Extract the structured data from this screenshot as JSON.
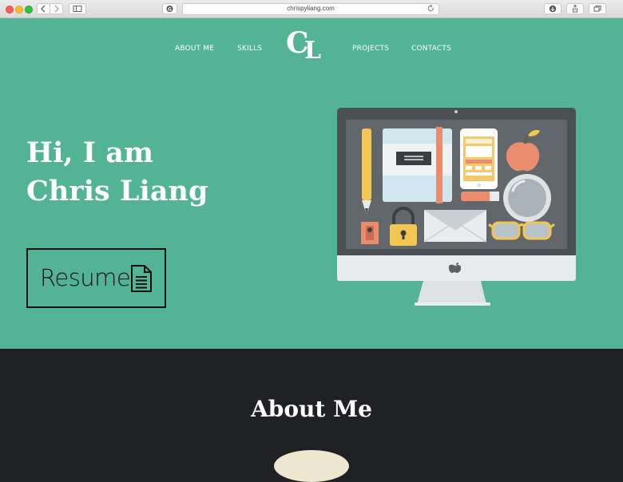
{
  "browser": {
    "url": "chrispyliang.com",
    "icons": {
      "back": "chevron-left-icon",
      "forward": "chevron-right-icon",
      "sidebar": "sidebar-icon",
      "site": "site-favicon-icon",
      "reload": "reload-icon",
      "download": "download-icon",
      "share": "share-icon",
      "tabs": "tabs-icon",
      "new_tab": "plus-icon"
    }
  },
  "nav": {
    "about": "ABOUT ME",
    "skills": "SKILLS",
    "logo_c": "C",
    "logo_l": "L",
    "projects": "PROJECTS",
    "contacts": "CONTACTS"
  },
  "hero": {
    "line1": "Hi, I am",
    "line2": "Chris Liang",
    "resume_label": "Resume",
    "illustration": "imac-desk-illustration"
  },
  "about": {
    "title": "About Me"
  },
  "colors": {
    "hero_bg": "#52b395",
    "dark_bg": "#1f2125",
    "text_light": "#ffffff",
    "text_dark": "#111111"
  }
}
